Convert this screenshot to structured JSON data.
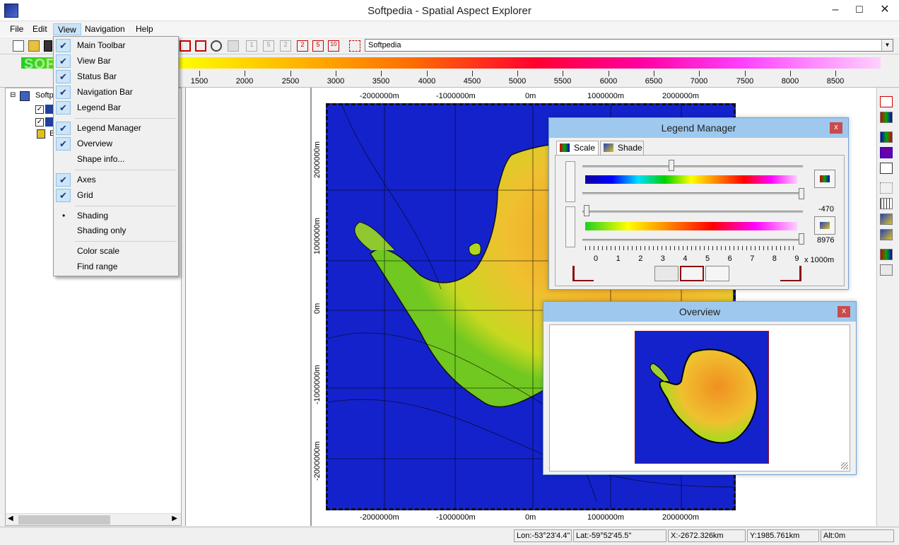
{
  "window": {
    "title": "Softpedia - Spatial Aspect Explorer",
    "min": "–",
    "max": "☐",
    "close": "✕"
  },
  "menu": [
    "File",
    "Edit",
    "View",
    "Navigation",
    "Help"
  ],
  "view_menu": [
    {
      "label": "Main Toolbar",
      "mark": "check"
    },
    {
      "label": "View Bar",
      "mark": "check"
    },
    {
      "label": "Status Bar",
      "mark": "check"
    },
    {
      "label": "Navigation Bar",
      "mark": "check"
    },
    {
      "label": "Legend Bar",
      "mark": "check"
    },
    {
      "label": "Legend Manager",
      "mark": "check"
    },
    {
      "label": "Overview",
      "mark": "check"
    },
    {
      "label": "Shape info...",
      "mark": ""
    },
    {
      "label": "Axes",
      "mark": "check"
    },
    {
      "label": "Grid",
      "mark": "check"
    },
    {
      "label": "Shading",
      "mark": "dot"
    },
    {
      "label": "Shading only",
      "mark": ""
    },
    {
      "label": "Color scale",
      "mark": ""
    },
    {
      "label": "Find range",
      "mark": ""
    }
  ],
  "toolbar": {
    "combo_value": "Softpedia",
    "zoom_buttons": [
      "1",
      "5",
      "2",
      "2",
      "5",
      "10"
    ]
  },
  "colorscale": {
    "labels": [
      "1500",
      "2000",
      "2500",
      "3000",
      "3500",
      "4000",
      "4500",
      "5000",
      "5500",
      "6000",
      "6500",
      "7000",
      "7500",
      "8000",
      "8500"
    ],
    "watermark": "SOFTPEDIA"
  },
  "tree": {
    "root": "Softp",
    "leaf": "E",
    "expand": "⊟"
  },
  "map": {
    "top_axis": [
      "-2000000m",
      "-1000000m",
      "0m",
      "1000000m",
      "2000000m"
    ],
    "bottom_axis": [
      "-2000000m",
      "-1000000m",
      "0m",
      "1000000m",
      "2000000m"
    ],
    "left_axis": [
      "2000000m",
      "1000000m",
      "0m",
      "-1000000m",
      "-2000000m"
    ]
  },
  "legend_manager": {
    "title": "Legend Manager",
    "tabs": [
      "Scale",
      "Shade"
    ],
    "min_value": "-470",
    "max_value": "8976",
    "ticks": [
      "0",
      "1",
      "2",
      "3",
      "4",
      "5",
      "6",
      "7",
      "8",
      "9"
    ],
    "unit": "x 1000m",
    "close": "x"
  },
  "overview": {
    "title": "Overview",
    "close": "x"
  },
  "status": {
    "lon": "Lon:-53°23'4.4\"",
    "lat": "Lat:-59°52'45.5\"",
    "x": "X:-2672.326km",
    "y": "Y:1985.761km",
    "alt": "Alt:0m"
  }
}
